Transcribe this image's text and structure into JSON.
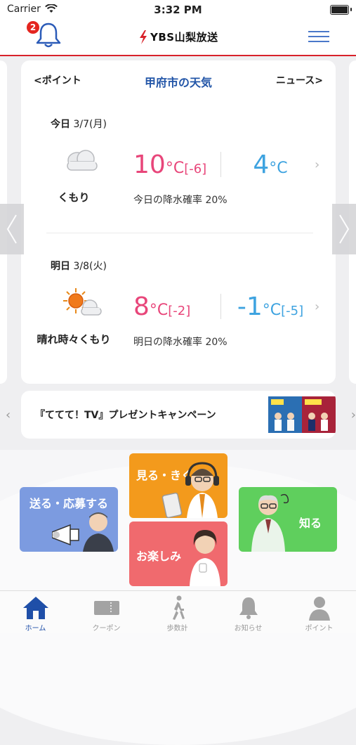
{
  "status_bar": {
    "carrier": "Carrier",
    "time": "3:32 PM"
  },
  "header": {
    "notification_count": "2",
    "logo_text": "YBS山梨放送"
  },
  "weather": {
    "prev_label": "<ポイント",
    "title": "甲府市の天気",
    "next_label": "ニュース>",
    "days": [
      {
        "label": "今日",
        "date": "3/7(月)",
        "icon": "cloud-icon",
        "condition": "くもり",
        "high": "10",
        "high_unit": "°C",
        "high_diff": "[-6]",
        "low": "4",
        "low_unit": "°C",
        "low_diff": "",
        "rain": "今日の降水確率 20%"
      },
      {
        "label": "明日",
        "date": "3/8(火)",
        "icon": "sun-cloud-icon",
        "condition": "晴れ時々くもり",
        "high": "8",
        "high_unit": "°C",
        "high_diff": "[-2]",
        "low": "-1",
        "low_unit": "°C",
        "low_diff": "[-5]",
        "rain": "明日の降水確率 20%"
      }
    ]
  },
  "banner": {
    "text": "『ててて！TV』プレゼントキャンペーン"
  },
  "tiles": {
    "send": "送る・応募する",
    "watch": "見る・きく",
    "fun": "お楽しみ",
    "know": "知る"
  },
  "tabs": [
    {
      "label": "ホーム",
      "icon": "home-icon"
    },
    {
      "label": "クーポン",
      "icon": "coupon-icon"
    },
    {
      "label": "歩数計",
      "icon": "walker-icon"
    },
    {
      "label": "お知らせ",
      "icon": "bell-icon"
    },
    {
      "label": "ポイント",
      "icon": "person-icon"
    }
  ],
  "colors": {
    "accent_red": "#d8222a",
    "title_blue": "#2356a8",
    "high_temp": "#e8467a",
    "low_temp": "#3ea3e0",
    "active_tab": "#1f4fa8"
  }
}
